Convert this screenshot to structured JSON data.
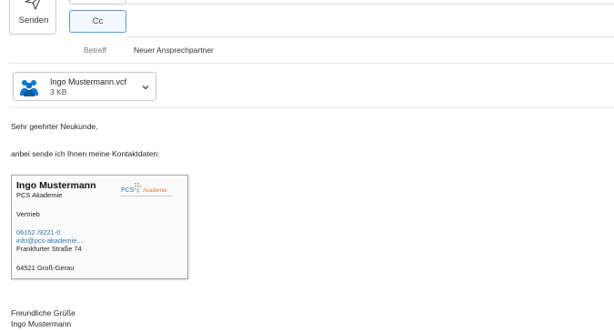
{
  "toolbar": {
    "send_label": "Senden",
    "cc_label": "Cc"
  },
  "subject": {
    "label": "Betreff",
    "value": "Neuer Ansprechpartner"
  },
  "attachment": {
    "name": "Ingo Mustermann.vcf",
    "size": "3 KB"
  },
  "body": {
    "greeting": "Sehr geehrter Neukunde,",
    "intro": "anbei sende ich Ihnen meine Kontaktdaten:",
    "closing": "Freundliche Grüße",
    "signature": "Ingo Mustermann"
  },
  "contact_card": {
    "name": "Ingo Mustermann",
    "company": "PCS Akademie",
    "role": "Vertrieb",
    "phone": "06152 /9221-0",
    "email": "info@pcs-akademie....",
    "street": "Frankfurter Straße 74",
    "city": "64521  Groß-Gerau",
    "logo_text": "PCS Akademie"
  },
  "colors": {
    "accent": "#5b9bd5",
    "link": "#2e75b6",
    "contacts_icon": "#0078d4"
  },
  "icons": {
    "send": "paper-plane-icon",
    "attachment": "contact-card-icon",
    "dropdown": "chevron-down-icon"
  }
}
